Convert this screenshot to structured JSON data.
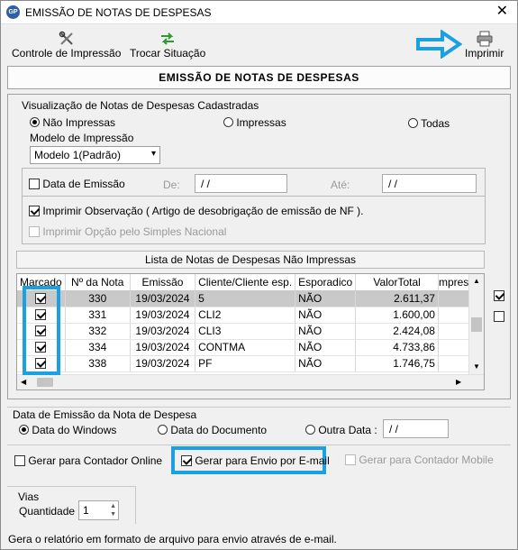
{
  "window": {
    "title": "EMISSÃO DE NOTAS DE DESPESAS",
    "app_icon": "GP"
  },
  "toolbar": {
    "controle_label": "Controle de Impressão",
    "trocar_label": "Trocar Situação",
    "imprimir_label": "Imprimir"
  },
  "header": {
    "title": "EMISSÃO DE NOTAS DE DESPESAS"
  },
  "visualizacao": {
    "group_label": "Visualização de Notas de Despesas Cadastradas",
    "opt_nao_impressas": "Não Impressas",
    "opt_impressas": "Impressas",
    "opt_todas": "Todas",
    "selected": "Não Impressas",
    "modelo_label": "Modelo de Impressão",
    "modelo_value": "Modelo 1(Padrão)"
  },
  "filtro": {
    "data_emissao_label": "Data de Emissão",
    "de_label": "De:",
    "de_value": "/ /",
    "ate_label": "Até:",
    "ate_value": "/ /",
    "imprimir_obs_label": "Imprimir Observação ( Artigo de desobrigação de emissão de NF ).",
    "imprimir_simples_label": "Imprimir Opção pelo Simples Nacional"
  },
  "lista": {
    "title": "Lista de Notas de Despesas Não Impressas",
    "columns": [
      "Marcado",
      "Nº da Nota",
      "Emissão",
      "Cliente/Cliente esp.",
      "Esporadico",
      "ValorTotal",
      "mpressa"
    ],
    "rows": [
      {
        "nota": "330",
        "emissao": "19/03/2024",
        "cliente": "5",
        "esporadico": "NÃO",
        "valor": "2.611,37"
      },
      {
        "nota": "331",
        "emissao": "19/03/2024",
        "cliente": "CLI2",
        "esporadico": "NÃO",
        "valor": "1.600,00"
      },
      {
        "nota": "332",
        "emissao": "19/03/2024",
        "cliente": "CLI3",
        "esporadico": "NÃO",
        "valor": "2.424,08"
      },
      {
        "nota": "334",
        "emissao": "19/03/2024",
        "cliente": "CONTMA",
        "esporadico": "NÃO",
        "valor": "4.733,86"
      },
      {
        "nota": "338",
        "emissao": "19/03/2024",
        "cliente": "PF",
        "esporadico": "NÃO",
        "valor": "1.746,75"
      }
    ]
  },
  "data_emissao_nota": {
    "group_label": "Data de Emissão da Nota de Despesa",
    "opt_windows": "Data do Windows",
    "opt_documento": "Data do Documento",
    "opt_outra": "Outra Data :",
    "outra_value": "/ /"
  },
  "opcoes": {
    "contador_online": "Gerar para Contador Online",
    "envio_email": "Gerar para Envio por E-mail",
    "contador_mobile": "Gerar para Contador Mobile"
  },
  "vias": {
    "group_label": "Vias",
    "quantidade_label": "Quantidade",
    "quantidade_value": "1"
  },
  "status": {
    "text": "Gera o relatório em formato de arquivo para envio através de e-mail."
  },
  "colors": {
    "highlight": "#1ba1e2",
    "selected_row": "#c9c9c9"
  }
}
